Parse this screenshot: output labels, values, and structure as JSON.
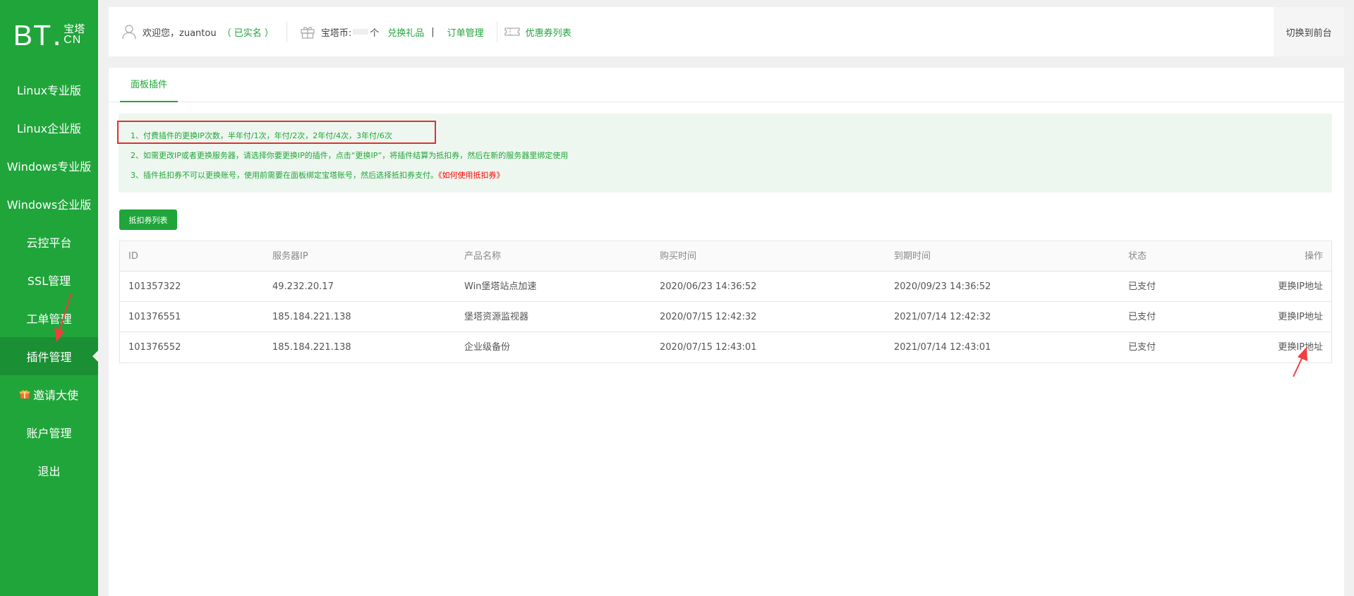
{
  "brand": {
    "logo_bt": "BT",
    "logo_dot": ".",
    "logo_cn_top": "宝塔",
    "logo_cn_bottom": "CN"
  },
  "sidebar": {
    "items": [
      {
        "label": "Linux专业版"
      },
      {
        "label": "Linux企业版"
      },
      {
        "label": "Windows专业版"
      },
      {
        "label": "Windows企业版"
      },
      {
        "label": "云控平台"
      },
      {
        "label": "SSL管理"
      },
      {
        "label": "工单管理"
      },
      {
        "label": "插件管理",
        "active": true
      },
      {
        "label": "邀请大使",
        "icon": "gift-icon"
      },
      {
        "label": "账户管理"
      },
      {
        "label": "退出"
      }
    ]
  },
  "header": {
    "welcome": "欢迎您，zuantou",
    "realname": "（ 已实名 ）",
    "coins_label": "宝塔币:",
    "coins_unit": "个",
    "exchange_gift": "兑换礼品",
    "pipe": "|",
    "order_manage": "订单管理",
    "coupon_list": "优惠券列表",
    "switch_front": "切换到前台"
  },
  "tabs": [
    {
      "label": "面板插件",
      "active": true
    }
  ],
  "notice": {
    "line1": "1、付费插件的更换IP次数，半年付/1次，年付/2次，2年付/4次，3年付/6次",
    "line2": "2、如需更改IP或者更换服务器，请选择你要更换IP的插件，点击“更换IP”，将插件结算为抵扣券，然后在新的服务器里绑定使用",
    "line3": "3、插件抵扣券不可以更换账号，使用前需要在面板绑定宝塔账号，然后选择抵扣券支付。",
    "line3_link": "《如何使用抵扣券》"
  },
  "coupon_button": "抵扣券列表",
  "table": {
    "columns": [
      "ID",
      "服务器IP",
      "产品名称",
      "购买时间",
      "到期时间",
      "状态",
      "操作"
    ],
    "rows": [
      {
        "id": "101357322",
        "ip": "49.232.20.17",
        "product": "Win堡塔站点加速",
        "buy_time": "2020/06/23 14:36:52",
        "expire_time": "2020/09/23 14:36:52",
        "status": "已支付",
        "action": "更换IP地址"
      },
      {
        "id": "101376551",
        "ip": "185.184.221.138",
        "product": "堡塔资源监视器",
        "buy_time": "2020/07/15 12:42:32",
        "expire_time": "2021/07/14 12:42:32",
        "status": "已支付",
        "action": "更换IP地址"
      },
      {
        "id": "101376552",
        "ip": "185.184.221.138",
        "product": "企业级备份",
        "buy_time": "2020/07/15 12:43:01",
        "expire_time": "2021/07/14 12:43:01",
        "status": "已支付",
        "action": "更换IP地址"
      }
    ]
  },
  "colors": {
    "brand_green": "#20a53a",
    "sidebar_active": "#1a8f33",
    "highlight_red": "#e03131",
    "notice_bg": "#eef7ef"
  }
}
